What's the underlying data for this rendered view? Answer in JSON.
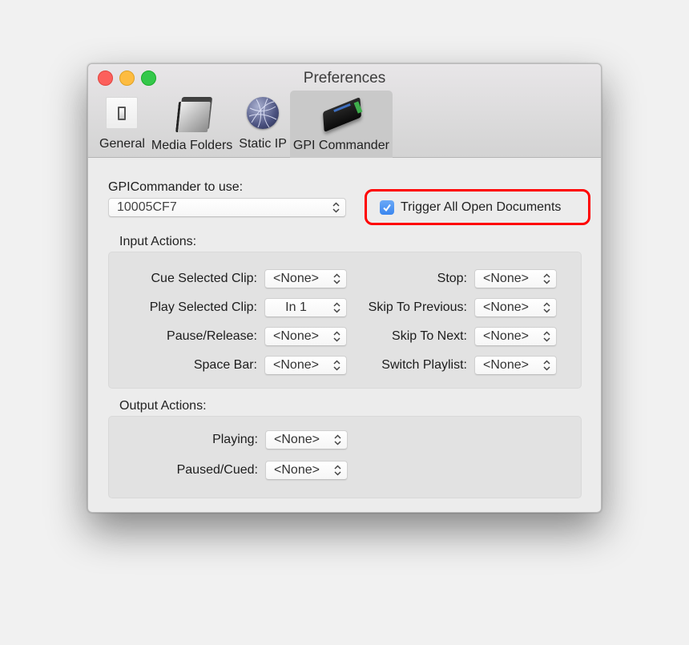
{
  "window": {
    "title": "Preferences",
    "traffic_lights": [
      "close",
      "minimize",
      "zoom"
    ]
  },
  "tabs": [
    {
      "label": "General",
      "icon": "light-switch-icon",
      "active": false
    },
    {
      "label": "Media Folders",
      "icon": "folder-icon",
      "active": false
    },
    {
      "label": "Static IP",
      "icon": "network-globe-icon",
      "active": false
    },
    {
      "label": "GPI Commander",
      "icon": "gpi-device-icon",
      "active": true
    }
  ],
  "gpi": {
    "label": "GPICommander to use:",
    "selected": "10005CF7",
    "trigger_all": {
      "label": "Trigger All Open Documents",
      "checked": true
    },
    "highlight_color": "#ff0000"
  },
  "input_actions": {
    "title": "Input Actions:",
    "left": [
      {
        "label": "Cue Selected Clip:",
        "value": "<None>"
      },
      {
        "label": "Play Selected Clip:",
        "value": "In 1"
      },
      {
        "label": "Pause/Release:",
        "value": "<None>"
      },
      {
        "label": "Space Bar:",
        "value": "<None>"
      }
    ],
    "right": [
      {
        "label": "Stop:",
        "value": "<None>"
      },
      {
        "label": "Skip To Previous:",
        "value": "<None>"
      },
      {
        "label": "Skip To Next:",
        "value": "<None>"
      },
      {
        "label": "Switch Playlist:",
        "value": "<None>"
      }
    ]
  },
  "output_actions": {
    "title": "Output Actions:",
    "items": [
      {
        "label": "Playing:",
        "value": "<None>"
      },
      {
        "label": "Paused/Cued:",
        "value": "<None>"
      }
    ]
  },
  "colors": {
    "checkbox": "#3a86ef",
    "close": "#fc605c",
    "minimize": "#fdbc40",
    "zoom": "#34c84a"
  }
}
